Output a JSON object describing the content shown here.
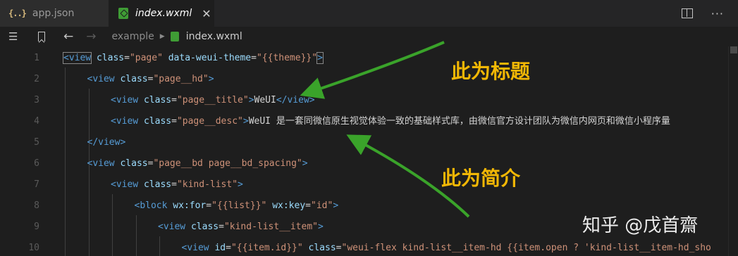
{
  "tabs": [
    {
      "icon": "{..}",
      "label": "app.json"
    },
    {
      "label": "index.wxml",
      "close": "✕"
    }
  ],
  "tab_actions": {
    "more": "···"
  },
  "breadcrumb": {
    "folder": "example",
    "separator": "▶",
    "file": "index.wxml"
  },
  "code_lines": [
    {
      "n": "1",
      "segs": [
        [
          "t",
          "<view"
        ],
        [
          "x",
          " "
        ],
        [
          "a",
          "class"
        ],
        [
          "x",
          "="
        ],
        [
          "s",
          "\"page\""
        ],
        [
          "x",
          " "
        ],
        [
          "a",
          "data-weui-theme"
        ],
        [
          "x",
          "="
        ],
        [
          "s",
          "\"{{theme}}\""
        ],
        [
          "t",
          ">"
        ]
      ]
    },
    {
      "n": "2",
      "segs": [
        [
          "t",
          "<view"
        ],
        [
          "x",
          " "
        ],
        [
          "a",
          "class"
        ],
        [
          "x",
          "="
        ],
        [
          "s",
          "\"page__hd\""
        ],
        [
          "t",
          ">"
        ]
      ]
    },
    {
      "n": "3",
      "segs": [
        [
          "t",
          "<view"
        ],
        [
          "x",
          " "
        ],
        [
          "a",
          "class"
        ],
        [
          "x",
          "="
        ],
        [
          "s",
          "\"page__title\""
        ],
        [
          "t",
          ">"
        ],
        [
          "x",
          "WeUI"
        ],
        [
          "t",
          "</view>"
        ]
      ]
    },
    {
      "n": "4",
      "segs": [
        [
          "t",
          "<view"
        ],
        [
          "x",
          " "
        ],
        [
          "a",
          "class"
        ],
        [
          "x",
          "="
        ],
        [
          "s",
          "\"page__desc\""
        ],
        [
          "t",
          ">"
        ],
        [
          "x",
          "WeUI 是一套同微信原生视觉体验一致的基础样式库，由微信官方设计团队为微信内网页和微信小程序量"
        ]
      ]
    },
    {
      "n": "5",
      "segs": [
        [
          "t",
          "</view>"
        ]
      ]
    },
    {
      "n": "6",
      "segs": [
        [
          "t",
          "<view"
        ],
        [
          "x",
          " "
        ],
        [
          "a",
          "class"
        ],
        [
          "x",
          "="
        ],
        [
          "s",
          "\"page__bd page__bd_spacing\""
        ],
        [
          "t",
          ">"
        ]
      ]
    },
    {
      "n": "7",
      "segs": [
        [
          "t",
          "<view"
        ],
        [
          "x",
          " "
        ],
        [
          "a",
          "class"
        ],
        [
          "x",
          "="
        ],
        [
          "s",
          "\"kind-list\""
        ],
        [
          "t",
          ">"
        ]
      ]
    },
    {
      "n": "8",
      "segs": [
        [
          "t",
          "<block"
        ],
        [
          "x",
          " "
        ],
        [
          "a",
          "wx:for"
        ],
        [
          "x",
          "="
        ],
        [
          "s",
          "\"{{list}}\""
        ],
        [
          "x",
          " "
        ],
        [
          "a",
          "wx:key"
        ],
        [
          "x",
          "="
        ],
        [
          "s",
          "\"id\""
        ],
        [
          "t",
          ">"
        ]
      ]
    },
    {
      "n": "9",
      "segs": [
        [
          "t",
          "<view"
        ],
        [
          "x",
          " "
        ],
        [
          "a",
          "class"
        ],
        [
          "x",
          "="
        ],
        [
          "s",
          "\"kind-list__item\""
        ],
        [
          "t",
          ">"
        ]
      ]
    },
    {
      "n": "10",
      "segs": [
        [
          "t",
          "<view"
        ],
        [
          "x",
          " "
        ],
        [
          "a",
          "id"
        ],
        [
          "x",
          "="
        ],
        [
          "s",
          "\"{{item.id}}\""
        ],
        [
          "x",
          " "
        ],
        [
          "a",
          "class"
        ],
        [
          "x",
          "="
        ],
        [
          "s",
          "\"weui-flex kind-list__item-hd {{item.open ? 'kind-list__item-hd_sho"
        ]
      ]
    }
  ],
  "annotations": {
    "title_label": "此为标题",
    "desc_label": "此为简介"
  },
  "watermark": "知乎 @戊首齋",
  "colors": {
    "annotation": "#f2b705",
    "arrow": "#3aa32a",
    "tag": "#569cd6",
    "attr": "#9cdcfe",
    "string": "#ce9178"
  }
}
